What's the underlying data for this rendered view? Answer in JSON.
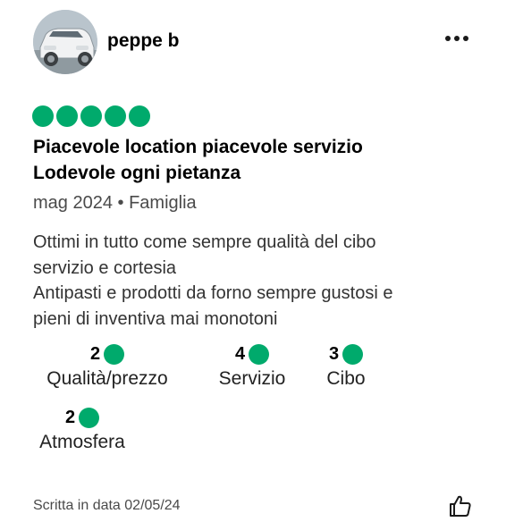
{
  "review": {
    "username": "peppe b",
    "rating": 5,
    "title": "Piacevole location piacevole servizio\nLodevole ogni pietanza",
    "meta": "mag 2024 • Famiglia",
    "body": "Ottimi in tutto come sempre qualità del cibo\nservizio e cortesia\nAntipasti e prodotti da forno sempre gustosi e\npieni di inventiva mai monotoni",
    "subratings": [
      {
        "score": "2",
        "label": "Qualità/prezzo"
      },
      {
        "score": "4",
        "label": "Servizio"
      },
      {
        "score": "3",
        "label": "Cibo"
      },
      {
        "score": "2",
        "label": "Atmosfera"
      }
    ],
    "written_date": "Scritta in data 02/05/24"
  },
  "icons": {
    "more": "more-options-icon",
    "like": "thumbs-up-icon",
    "rating_bubble": "rating-bubble-icon"
  },
  "colors": {
    "accent": "#00aa6c"
  }
}
